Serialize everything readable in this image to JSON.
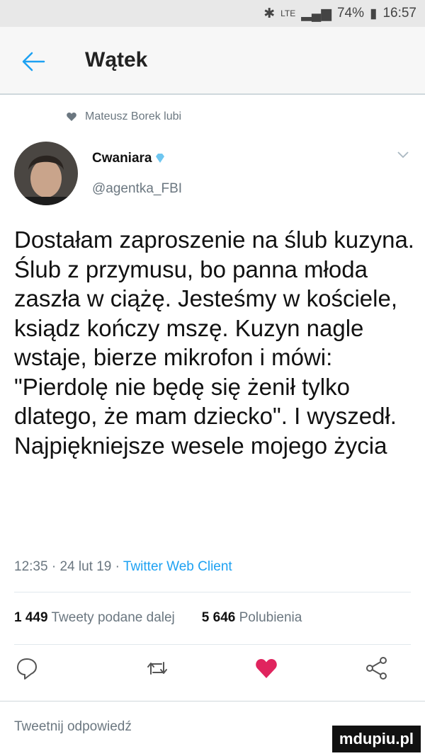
{
  "status_bar": {
    "signal_label": "LTE",
    "battery": "74%",
    "time": "16:57"
  },
  "header": {
    "title": "Wątek"
  },
  "context": {
    "liked_by": "Mateusz Borek lubi"
  },
  "author": {
    "name": "Cwaniara",
    "handle": "@agentka_FBI"
  },
  "tweet": {
    "text": "Dostałam zaproszenie na ślub kuzyna. Ślub z przymusu, bo panna młoda zaszła w ciążę. Jesteśmy w kościele, ksiądz kończy mszę. Kuzyn nagle wstaje, bierze mikrofon i mówi: \"Pierdolę nie będę się żenił tylko dlatego, że mam dziecko\". I wyszedł. Najpiękniejsze wesele mojego życia",
    "time": "12:35",
    "date": "24 lut 19",
    "client": "Twitter Web Client",
    "separator": "·"
  },
  "stats": {
    "retweets_count": "1 449",
    "retweets_label": "Tweety podane dalej",
    "likes_count": "5 646",
    "likes_label": "Polubienia"
  },
  "actions": [
    "reply-icon",
    "retweet-icon",
    "like-icon",
    "share-icon"
  ],
  "reply": {
    "placeholder": "Tweetnij odpowiedź"
  },
  "watermark": {
    "text": "mdupiu.pl"
  },
  "colors": {
    "accent": "#1da1f2",
    "like": "#e0245e",
    "muted": "#6b7780"
  }
}
